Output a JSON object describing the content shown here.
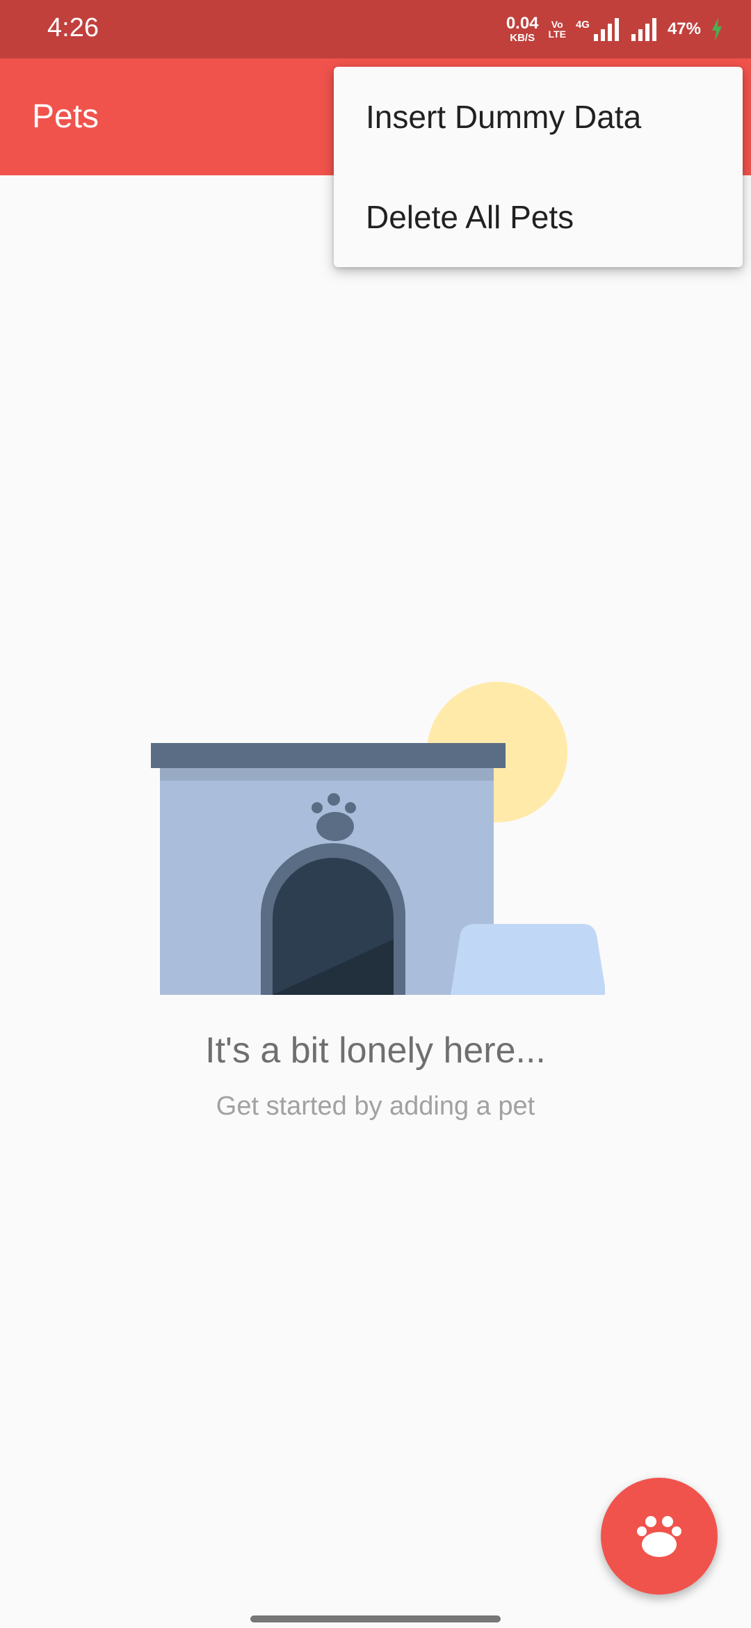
{
  "status_bar": {
    "time": "4:26",
    "net_speed_value": "0.04",
    "net_speed_unit": "KB/S",
    "volte_top": "Vo",
    "volte_bottom": "LTE",
    "network_type": "4G",
    "battery_percent": "47%",
    "icons": [
      "signal-icon",
      "signal-icon",
      "charging-icon"
    ]
  },
  "app_bar": {
    "title": "Pets"
  },
  "overflow_menu": {
    "items": [
      {
        "label": "Insert Dummy Data"
      },
      {
        "label": "Delete All Pets"
      }
    ]
  },
  "empty_state": {
    "illustration": "pet-house-illustration",
    "title": "It's a bit lonely here...",
    "subtitle": "Get started by adding a pet"
  },
  "fab": {
    "icon": "paw-icon"
  },
  "colors": {
    "status_bar": "#c1403c",
    "app_bar": "#f0534c",
    "fab": "#f0534c",
    "background": "#fafafa",
    "menu_background": "#fafafa"
  }
}
